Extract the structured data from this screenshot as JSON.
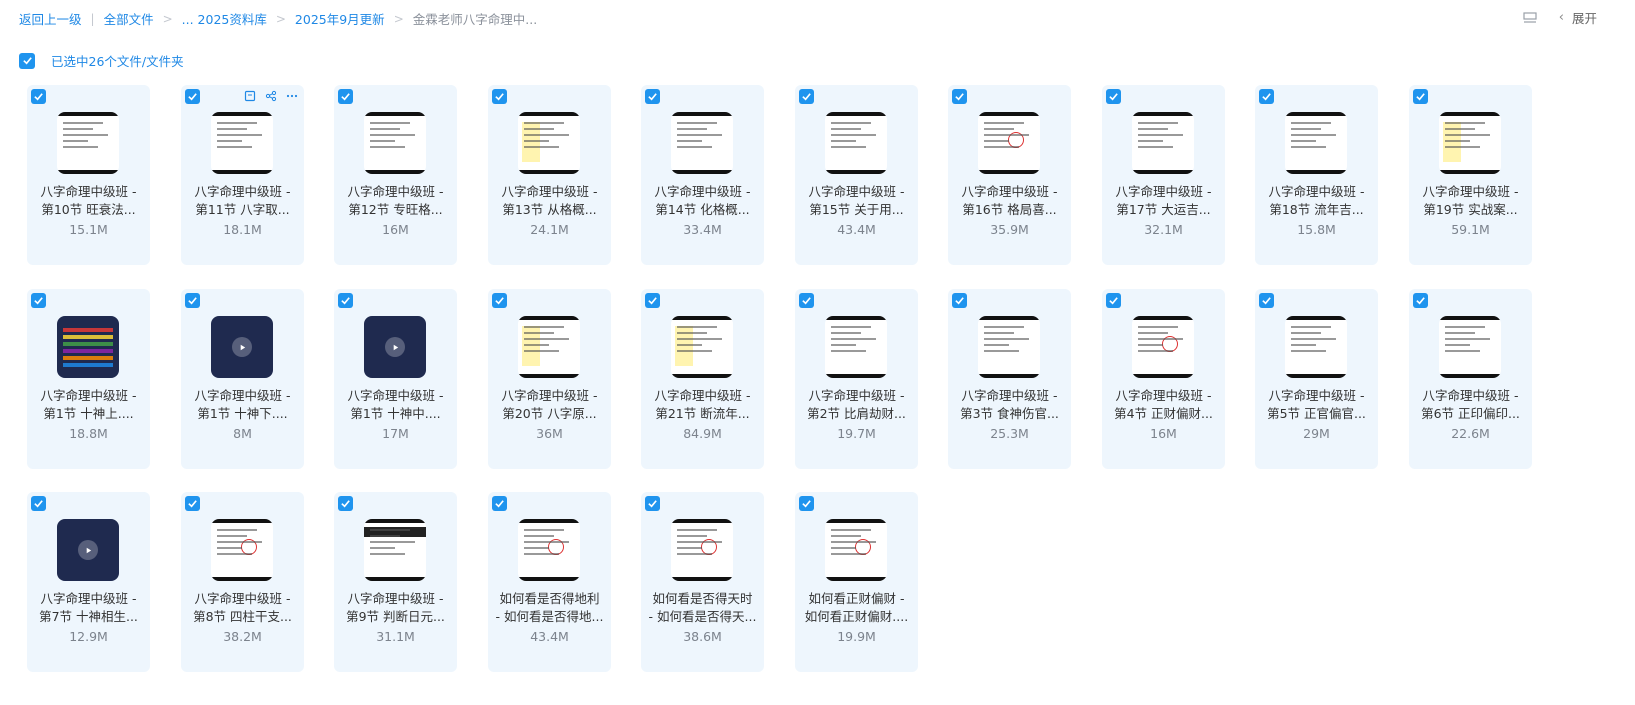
{
  "breadcrumb": {
    "back": "返回上一级",
    "all_files": "全部文件",
    "library": "... 2025资料库",
    "september": "2025年9月更新",
    "current": "金霖老师八字命理中..."
  },
  "topright": {
    "expand_label": "展开"
  },
  "selection": {
    "label": "已选中26个文件/文件夹"
  },
  "colors": {
    "accent": "#1f88e5",
    "card_bg": "#eef6fd",
    "checkbox": "#1f94ee"
  },
  "files": [
    {
      "name": "八字命理中级班 -\n第10节 旺衰法...",
      "size": "15.1M",
      "thumb": "light"
    },
    {
      "name": "八字命理中级班 -\n第11节 八字取...",
      "size": "18.1M",
      "thumb": "light"
    },
    {
      "name": "八字命理中级班 -\n第12节 专旺格...",
      "size": "16M",
      "thumb": "light"
    },
    {
      "name": "八字命理中级班 -\n第13节 从格概...",
      "size": "24.1M",
      "thumb": "yellow"
    },
    {
      "name": "八字命理中级班 -\n第14节 化格概...",
      "size": "33.4M",
      "thumb": "light"
    },
    {
      "name": "八字命理中级班 -\n第15节 关于用...",
      "size": "43.4M",
      "thumb": "light"
    },
    {
      "name": "八字命理中级班 -\n第16节 格局喜...",
      "size": "35.9M",
      "thumb": "red"
    },
    {
      "name": "八字命理中级班 -\n第17节 大运吉...",
      "size": "32.1M",
      "thumb": "light"
    },
    {
      "name": "八字命理中级班 -\n第18节 流年吉...",
      "size": "15.8M",
      "thumb": "light"
    },
    {
      "name": "八字命理中级班 -\n第19节 实战案...",
      "size": "59.1M",
      "thumb": "yellow"
    },
    {
      "name": "八字命理中级班 -\n第1节 十神上....",
      "size": "18.8M",
      "thumb": "colorful"
    },
    {
      "name": "八字命理中级班 -\n第1节 十神下....",
      "size": "8M",
      "thumb": "video"
    },
    {
      "name": "八字命理中级班 -\n第1节 十神中....",
      "size": "17M",
      "thumb": "video"
    },
    {
      "name": "八字命理中级班 -\n第20节 八字原...",
      "size": "36M",
      "thumb": "yellow"
    },
    {
      "name": "八字命理中级班 -\n第21节 断流年...",
      "size": "84.9M",
      "thumb": "yellow"
    },
    {
      "name": "八字命理中级班 -\n第2节 比肩劫财...",
      "size": "19.7M",
      "thumb": "light"
    },
    {
      "name": "八字命理中级班 -\n第3节 食神伤官...",
      "size": "25.3M",
      "thumb": "light"
    },
    {
      "name": "八字命理中级班 -\n第4节 正财偏财...",
      "size": "16M",
      "thumb": "red"
    },
    {
      "name": "八字命理中级班 -\n第5节 正官偏官...",
      "size": "29M",
      "thumb": "light"
    },
    {
      "name": "八字命理中级班 -\n第6节 正印偏印...",
      "size": "22.6M",
      "thumb": "light"
    },
    {
      "name": "八字命理中级班 -\n第7节 十神相生...",
      "size": "12.9M",
      "thumb": "video"
    },
    {
      "name": "八字命理中级班 -\n第8节 四柱干支...",
      "size": "38.2M",
      "thumb": "red"
    },
    {
      "name": "八字命理中级班 -\n第9节 判断日元...",
      "size": "31.1M",
      "thumb": "table"
    },
    {
      "name": "如何看是否得地利\n- 如何看是否得地...",
      "size": "43.4M",
      "thumb": "red"
    },
    {
      "name": "如何看是否得天时\n- 如何看是否得天...",
      "size": "38.6M",
      "thumb": "red"
    },
    {
      "name": "如何看正财偏财 -\n如何看正财偏财....",
      "size": "19.9M",
      "thumb": "red"
    }
  ]
}
